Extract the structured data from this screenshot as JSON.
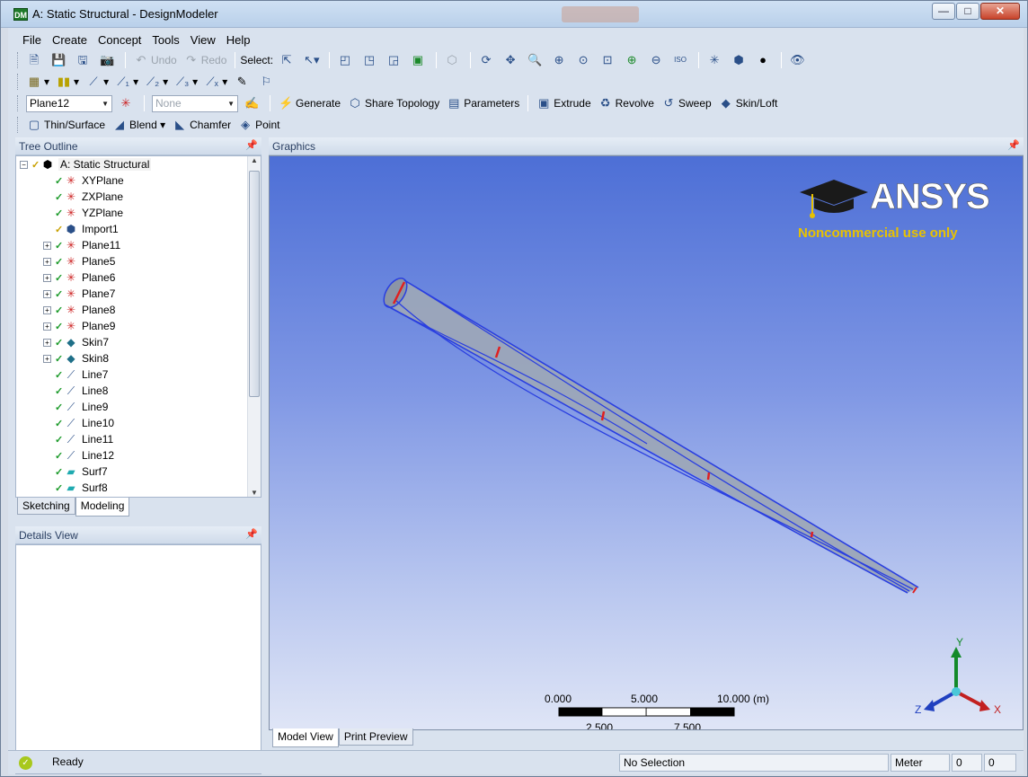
{
  "window": {
    "title": "A: Static Structural - DesignModeler",
    "app_icon": "DM",
    "controls": {
      "minimize": "—",
      "maximize": "□",
      "close": "✕"
    }
  },
  "menu": [
    "File",
    "Create",
    "Concept",
    "Tools",
    "View",
    "Help"
  ],
  "toolbar1": {
    "undo": "Undo",
    "redo": "Redo",
    "select": "Select:"
  },
  "toolbar3": {
    "plane_value": "Plane12",
    "sketch_value": "None",
    "generate": "Generate",
    "share_topology": "Share Topology",
    "parameters": "Parameters",
    "extrude": "Extrude",
    "revolve": "Revolve",
    "sweep": "Sweep",
    "skin_loft": "Skin/Loft"
  },
  "toolbar4": {
    "thin_surface": "Thin/Surface",
    "blend": "Blend",
    "chamfer": "Chamfer",
    "point": "Point"
  },
  "tree": {
    "header": "Tree Outline",
    "root": "A: Static Structural",
    "items": [
      {
        "label": "XYPlane",
        "icon": "plane-icon",
        "expandable": false
      },
      {
        "label": "ZXPlane",
        "icon": "plane-icon",
        "expandable": false
      },
      {
        "label": "YZPlane",
        "icon": "plane-icon",
        "expandable": false
      },
      {
        "label": "Import1",
        "icon": "import-icon",
        "expandable": false
      },
      {
        "label": "Plane11",
        "icon": "plane-icon",
        "expandable": true
      },
      {
        "label": "Plane5",
        "icon": "plane-icon",
        "expandable": true
      },
      {
        "label": "Plane6",
        "icon": "plane-icon",
        "expandable": true
      },
      {
        "label": "Plane7",
        "icon": "plane-icon",
        "expandable": true
      },
      {
        "label": "Plane8",
        "icon": "plane-icon",
        "expandable": true
      },
      {
        "label": "Plane9",
        "icon": "plane-icon",
        "expandable": true
      },
      {
        "label": "Skin7",
        "icon": "skin-icon",
        "expandable": true
      },
      {
        "label": "Skin8",
        "icon": "skin-icon",
        "expandable": true
      },
      {
        "label": "Line7",
        "icon": "line-icon",
        "expandable": false
      },
      {
        "label": "Line8",
        "icon": "line-icon",
        "expandable": false
      },
      {
        "label": "Line9",
        "icon": "line-icon",
        "expandable": false
      },
      {
        "label": "Line10",
        "icon": "line-icon",
        "expandable": false
      },
      {
        "label": "Line11",
        "icon": "line-icon",
        "expandable": false
      },
      {
        "label": "Line12",
        "icon": "line-icon",
        "expandable": false
      },
      {
        "label": "Surf7",
        "icon": "surface-icon",
        "expandable": false
      },
      {
        "label": "Surf8",
        "icon": "surface-icon",
        "expandable": false
      }
    ],
    "tabs": {
      "sketching": "Sketching",
      "modeling": "Modeling"
    }
  },
  "details": {
    "header": "Details View"
  },
  "graphics": {
    "header": "Graphics",
    "logo_text": "ANSYS",
    "logo_sub": "Noncommercial use only",
    "scale_labels_top": [
      "0.000",
      "5.000",
      "10.000 (m)"
    ],
    "scale_labels_bottom": [
      "2.500",
      "7.500"
    ],
    "axes": {
      "x": "X",
      "y": "Y",
      "z": "Z"
    },
    "tabs": {
      "model_view": "Model View",
      "print_preview": "Print Preview"
    },
    "colors": {
      "edge": "#2a3fe0",
      "section": "#e02020",
      "body": "#9aa6b8"
    }
  },
  "status": {
    "ready": "Ready",
    "selection": "No Selection",
    "units": "Meter",
    "v1": "0",
    "v2": "0"
  }
}
